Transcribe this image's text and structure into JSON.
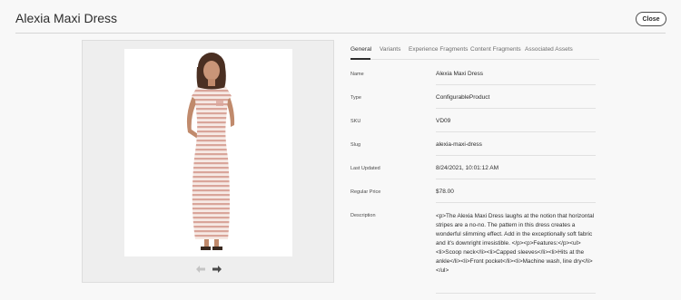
{
  "header": {
    "title": "Alexia Maxi Dress",
    "close_label": "Close"
  },
  "image": {
    "alt": "Model wearing striped maxi dress",
    "nav_prev_icon": "arrow-left-icon",
    "nav_next_icon": "arrow-right-icon"
  },
  "tabs": [
    {
      "label": "General",
      "active": true
    },
    {
      "label": "Variants",
      "active": false
    },
    {
      "label": "Experience Fragments",
      "active": false
    },
    {
      "label": "Content Fragments",
      "active": false
    },
    {
      "label": "Associated Assets",
      "active": false
    }
  ],
  "fields": {
    "name": {
      "label": "Name",
      "value": "Alexia Maxi Dress"
    },
    "type": {
      "label": "Type",
      "value": "ConfigurableProduct"
    },
    "sku": {
      "label": "SKU",
      "value": "VD09"
    },
    "slug": {
      "label": "Slug",
      "value": "alexia-maxi-dress"
    },
    "last_updated": {
      "label": "Last Updated",
      "value": "8/24/2021, 10:01:12 AM"
    },
    "regular_price": {
      "label": "Regular Price",
      "value": "$78.00"
    },
    "description": {
      "label": "Description",
      "value": "<p>The Alexia Maxi Dress laughs at the notion that horizontal stripes are a no-no. The pattern in this dress creates a wonderful slimming effect. Add in the exceptionally soft fabric and it's downright irresistible.     </p><p>Features:</p><ul><li>Scoop neck</li><li>Capped sleeves</li><li>Hits at the ankle</li><li>Front pocket</li><li>Machine wash, line dry</li></ul>"
    }
  },
  "colors": {
    "background": "#f8f8f8",
    "stripe": "#d9a59a",
    "text": "#2c2c2c"
  }
}
